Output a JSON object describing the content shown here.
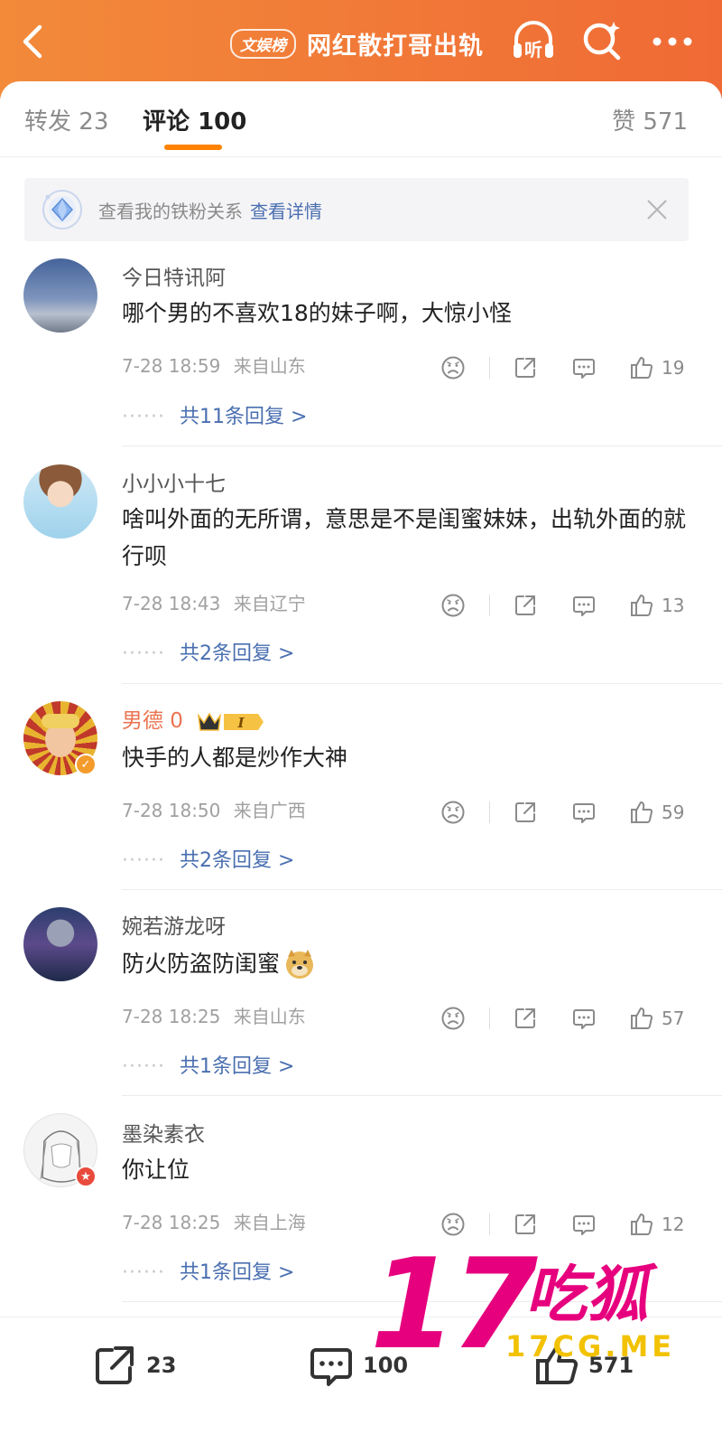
{
  "header": {
    "topic_badge": "文娱榜",
    "title": "网红散打哥出轨",
    "listen_label": "听"
  },
  "tabs": {
    "repost_label": "转发",
    "repost_count": "23",
    "comment_label": "评论",
    "comment_count": "100",
    "like_label": "赞",
    "like_count": "571"
  },
  "fan_banner": {
    "text": "查看我的铁粉关系",
    "link": "查看详情"
  },
  "comments": [
    {
      "username": "今日特讯阿",
      "text": "哪个男的不喜欢18的妹子啊，大惊小怪",
      "time": "7-28 18:59",
      "location": "来自山东",
      "likes": "19",
      "replies": "共11条回复 >"
    },
    {
      "username": "小小小十七",
      "text": "啥叫外面的无所谓，意思是不是闺蜜妹妹，出轨外面的就行呗",
      "time": "7-28 18:43",
      "location": "来自辽宁",
      "likes": "13",
      "replies": "共2条回复 >"
    },
    {
      "username": "男德 0",
      "text": "快手的人都是炒作大神",
      "time": "7-28 18:50",
      "location": "来自广西",
      "likes": "59",
      "replies": "共2条回复 >"
    },
    {
      "username": "婉若游龙呀",
      "text": "防火防盗防闺蜜",
      "time": "7-28 18:25",
      "location": "来自山东",
      "likes": "57",
      "replies": "共1条回复 >"
    },
    {
      "username": "墨染素衣",
      "text": "你让位",
      "time": "7-28 18:25",
      "location": "来自上海",
      "likes": "12",
      "replies": "共1条回复 >"
    }
  ],
  "vip_badge": "I",
  "bottom_bar": {
    "repost_count": "23",
    "comment_count": "100",
    "like_count": "571"
  },
  "watermark": {
    "number": "17",
    "chinese": "吃狐",
    "url": "17CG.ME"
  },
  "colors": {
    "header_start": "#f28a3a",
    "header_end": "#f06a35",
    "accent": "#ff8200",
    "link": "#4a6fb0",
    "vip_name": "#eb7350",
    "watermark_pink": "#e6007e",
    "watermark_yellow": "#f2c200"
  }
}
